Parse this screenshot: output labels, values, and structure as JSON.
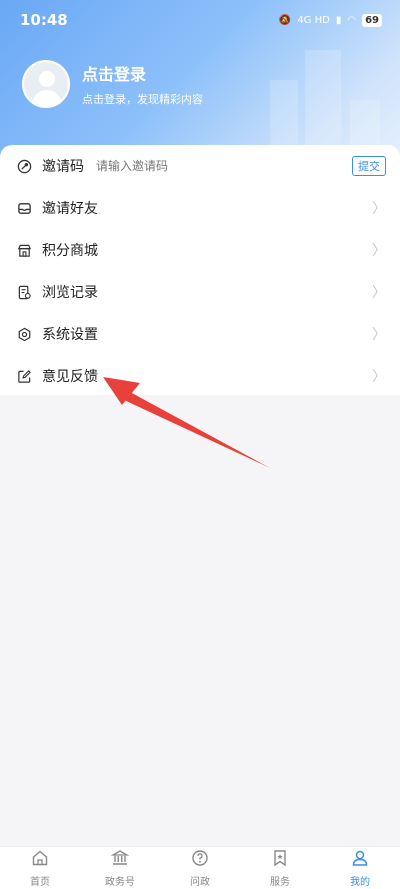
{
  "status_bar": {
    "time": "10:48",
    "network": "4G HD",
    "battery": "69"
  },
  "profile": {
    "title": "点击登录",
    "subtitle": "点击登录，发现精彩内容"
  },
  "invite": {
    "label": "邀请码",
    "placeholder": "请输入邀请码",
    "submit": "提交"
  },
  "menu": [
    {
      "label": "邀请好友",
      "icon": "inbox-icon"
    },
    {
      "label": "积分商城",
      "icon": "shop-icon"
    },
    {
      "label": "浏览记录",
      "icon": "history-icon"
    },
    {
      "label": "系统设置",
      "icon": "settings-icon"
    },
    {
      "label": "意见反馈",
      "icon": "edit-icon"
    }
  ],
  "tabs": [
    {
      "label": "首页",
      "icon": "home-icon",
      "active": false
    },
    {
      "label": "政务号",
      "icon": "government-icon",
      "active": false
    },
    {
      "label": "问政",
      "icon": "question-icon",
      "active": false
    },
    {
      "label": "服务",
      "icon": "bookmark-icon",
      "active": false
    },
    {
      "label": "我的",
      "icon": "user-icon",
      "active": true
    }
  ],
  "colors": {
    "accent": "#3a8ee6",
    "annotation_arrow": "#e8403a"
  }
}
